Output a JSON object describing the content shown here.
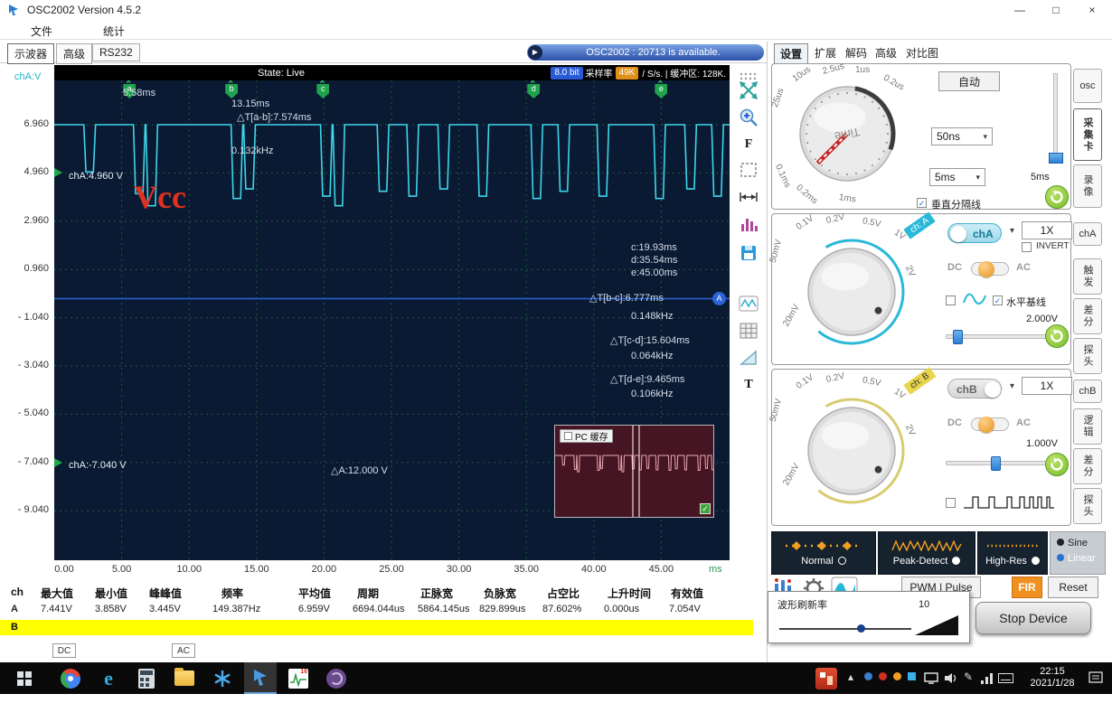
{
  "window": {
    "title": "OSC2002  Version 4.5.2",
    "controls": {
      "minimize": "—",
      "maximize": "□",
      "close": "×"
    },
    "menu": {
      "file": "文件",
      "stats": "统计"
    }
  },
  "doc_tabs": {
    "oscilloscope": "示波器",
    "advanced": "高级",
    "rs232": "RS232"
  },
  "status_banner": {
    "text": "OSC2002 : 20713 is available.",
    "play_glyph": "▶"
  },
  "scope": {
    "state": "State: Live",
    "bit_badge": "8.0 bit",
    "sample_label": "采样率",
    "sample_value": "49K",
    "sample_suffix": "/ S/s. | 缓冲区: 128K.",
    "axis_channel": "chA:V",
    "y_labels": [
      "6.960",
      "4.960",
      "2.960",
      "0.960",
      "- 1.040",
      "- 3.040",
      "- 5.040",
      "- 7.040",
      "- 9.040"
    ],
    "x_labels": [
      "0.00",
      "5.00",
      "10.00",
      "15.00",
      "20.00",
      "25.00",
      "30.00",
      "35.00",
      "40.00",
      "45.00"
    ],
    "x_unit": "ms",
    "markers": [
      {
        "letter": "a",
        "t_ms": 5.58
      },
      {
        "letter": "b",
        "t_ms": 13.15
      },
      {
        "letter": "c",
        "t_ms": 19.93
      },
      {
        "letter": "d",
        "t_ms": 35.54
      },
      {
        "letter": "e",
        "t_ms": 45.0
      }
    ],
    "annotations": {
      "a_time": "5.58ms",
      "b_time": "13.15ms",
      "t_ab": "△T[a-b]:7.574ms",
      "f_ab": "0.132kHz",
      "c_time": "c:19.93ms",
      "d_time": "d:35.54ms",
      "e_time": "e:45.00ms",
      "t_bc": "△T[b-c]:6.777ms",
      "f_bc": "0.148kHz",
      "t_cd": "△T[c-d]:15.604ms",
      "f_cd": "0.064kHz",
      "t_de": "△T[d-e]:9.465ms",
      "f_de": "0.106kHz",
      "amp": "△A:12.000 V"
    },
    "vcc": "Vcc",
    "marker_top_label": "chA:4.960 V",
    "marker_bottom_label": "chA:-7.040 V",
    "trigger_badge": "A",
    "trigger_v": -0.25,
    "pc_cache": {
      "label": "PC 缓存"
    },
    "waveform": {
      "high_v": 6.96,
      "t_start": -0.05,
      "t_end": 50.2,
      "dip_width_ms": 0.55,
      "edge_ms": 0.16,
      "dips": [
        [
          2.35,
          5.0
        ],
        [
          6.03,
          4.1
        ],
        [
          6.95,
          3.6
        ],
        [
          13.27,
          3.9
        ],
        [
          14.2,
          4.3
        ],
        [
          19.9,
          4.0
        ],
        [
          20.82,
          3.6
        ],
        [
          24.1,
          4.2
        ],
        [
          26.3,
          4.0
        ],
        [
          28.6,
          4.3
        ],
        [
          31.5,
          4.0
        ],
        [
          35.5,
          3.9
        ],
        [
          37.5,
          4.2
        ],
        [
          40.4,
          4.0
        ],
        [
          44.6,
          3.9
        ],
        [
          46.9,
          4.3
        ],
        [
          48.9,
          4.0
        ]
      ]
    }
  },
  "toolbar": {
    "f_label": "F",
    "t_label": "T",
    "icons": [
      "drag-dots",
      "move",
      "zoom-in",
      "frame-select",
      "horizontal-measure",
      "histogram",
      "save",
      "waveform-view",
      "grid-view",
      "triangle-measure"
    ]
  },
  "measurements": {
    "headers": [
      "ch",
      "最大值",
      "最小值",
      "峰峰值",
      "频率",
      "平均值",
      "周期",
      "正脉宽",
      "负脉宽",
      "占空比",
      "上升时间",
      "有效值"
    ],
    "row_a": {
      "ch": "A",
      "values": [
        "7.441V",
        "3.858V",
        "3.445V",
        "149.387Hz",
        "6.959V",
        "6694.044us",
        "5864.145us",
        "829.899us",
        "87.602%",
        "0.000us",
        "7.054V"
      ]
    },
    "row_b": {
      "ch": "B"
    },
    "legend": [
      "DC",
      "AC"
    ]
  },
  "panel": {
    "tabs": [
      "设置",
      "扩展",
      "解码",
      "高级",
      "对比图"
    ],
    "time": {
      "knob_text": "Time",
      "ticks": [
        "10us",
        "2.5us",
        "1us",
        "0.2us",
        "25us",
        "0.1ms",
        "0.2ms",
        "1ms"
      ],
      "auto": "自动",
      "select_small": "50ns",
      "select_main": "5ms",
      "slider_label": "5ms",
      "divider_label": "垂直分隔线"
    },
    "chA": {
      "ribbon": "ch: A",
      "name": "chA",
      "gain": "1X",
      "invert": "INVERT",
      "dc": "DC",
      "ac": "AC",
      "baseline": "水平基线",
      "offset": "2.000V",
      "ticks": [
        "0.1V",
        "0.2V",
        "0.5V",
        "1V",
        "2V",
        "50mV",
        "20mV"
      ]
    },
    "chB": {
      "ribbon": "ch: B",
      "name": "chB",
      "gain": "1X",
      "dc": "DC",
      "ac": "AC",
      "offset": "1.000V",
      "ticks": [
        "0.1V",
        "0.2V",
        "0.5V",
        "1V",
        "2V",
        "50mV",
        "20mV"
      ]
    },
    "side_tabs": [
      "osc",
      "采集卡",
      "录像",
      "chA",
      "触发",
      "差分",
      "探头",
      "chB",
      "逻辑",
      "差分",
      "探头"
    ],
    "modes": {
      "normal": "Normal",
      "peak": "Peak-Detect",
      "highres": "High-Res",
      "sine": "Sine",
      "linear": "Linear"
    },
    "tools": {
      "pwm": "PWM | Pulse",
      "fir": "FIR",
      "reset": "Reset"
    },
    "refresh": {
      "label": "波形刷新率",
      "value": "10"
    },
    "stop": "Stop Device"
  },
  "taskbar": {
    "time": "22:15",
    "date": "2021/1/28"
  }
}
